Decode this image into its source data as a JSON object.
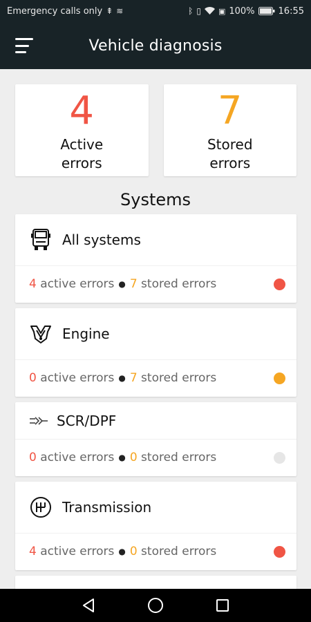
{
  "status_bar": {
    "carrier": "Emergency calls only",
    "battery": "100%",
    "time": "16:55"
  },
  "app_bar": {
    "menu_icon": "hamburger-menu-icon",
    "title": "Vehicle diagnosis"
  },
  "summary": {
    "active": {
      "count": "4",
      "label_line1": "Active",
      "label_line2": "errors",
      "color": "#f05545"
    },
    "stored": {
      "count": "7",
      "label_line1": "Stored",
      "label_line2": "errors",
      "color": "#f5a623"
    }
  },
  "section_title": "Systems",
  "systems": [
    {
      "name": "All systems",
      "icon": "truck-front-icon",
      "active": "4",
      "stored": "7",
      "active_text": "active errors",
      "stored_text": "stored errors",
      "status_color": "#f05545"
    },
    {
      "name": "Engine",
      "icon": "engine-icon",
      "active": "0",
      "stored": "7",
      "active_text": "active errors",
      "stored_text": "stored errors",
      "status_color": "#f5a623"
    },
    {
      "name": "SCR/DPF",
      "icon": "exhaust-filter-icon",
      "active": "0",
      "stored": "0",
      "active_text": "active errors",
      "stored_text": "stored errors",
      "status_color": "#e6e6e6"
    },
    {
      "name": "Transmission",
      "icon": "gear-shift-icon",
      "active": "4",
      "stored": "0",
      "active_text": "active errors",
      "stored_text": "stored errors",
      "status_color": "#f05545"
    }
  ],
  "nav_bar": {
    "back_icon": "back-triangle-icon",
    "home_icon": "home-circle-icon",
    "recents_icon": "recents-square-icon"
  }
}
